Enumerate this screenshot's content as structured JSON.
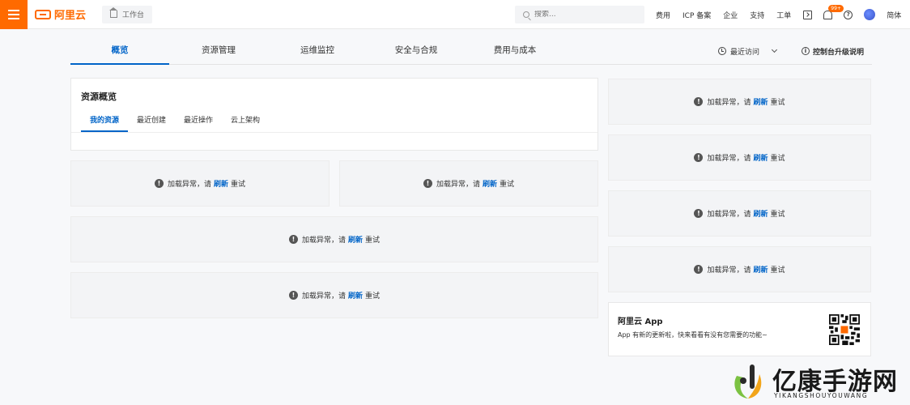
{
  "header": {
    "brand": "阿里云",
    "workbench_label": "工作台",
    "search_placeholder": "搜索...",
    "links": [
      "费用",
      "ICP 备案",
      "企业",
      "支持",
      "工单"
    ],
    "notification_count": "99+",
    "language": "简体",
    "accent_color": "#ff6a00"
  },
  "tabs": [
    {
      "label": "概览",
      "active": true
    },
    {
      "label": "资源管理",
      "active": false
    },
    {
      "label": "运维监控",
      "active": false
    },
    {
      "label": "安全与合规",
      "active": false
    },
    {
      "label": "费用与成本",
      "active": false
    }
  ],
  "tab_actions": {
    "recent_visits": "最近访问",
    "upgrade_note": "控制台升级说明"
  },
  "overview": {
    "title": "资源概览",
    "sub_tabs": [
      "我的资源",
      "最近创建",
      "最近操作",
      "云上架构"
    ]
  },
  "error": {
    "prefix": "加载异常，请",
    "link": "刷新",
    "suffix": "重试",
    "icon": "!"
  },
  "app_card": {
    "title": "阿里云 App",
    "description": "App 有新的更新啦，快来看看有没有您需要的功能~"
  },
  "watermark": {
    "title": "亿康手游网",
    "subtitle": "YIKANGSHOUYOUWANG"
  },
  "link_color": "#0064c8"
}
